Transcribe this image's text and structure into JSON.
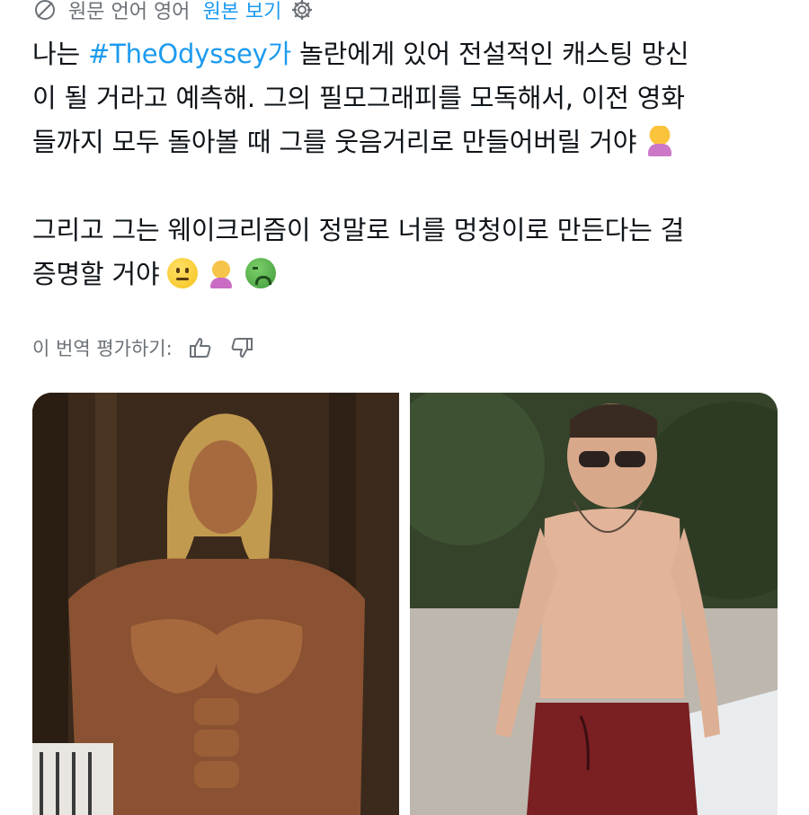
{
  "translate_bar": {
    "source_label": "원문 언어 영어",
    "view_original": "원본 보기",
    "globe_icon": "globe-icon",
    "settings_icon": "gear-icon"
  },
  "tweet": {
    "lines_p1": [
      "이 될 거라고 예측해. 그의 필모그래피를 모독해서, 이전 영화",
      "들까지 모두 돌아볼 때 그를 웃음거리로 만들어버릴 거야"
    ],
    "p1_start": "나는 ",
    "hashtag": "#TheOdyssey가",
    "p1_after_hashtag": " 놀란에게 있어 전설적인 캐스팅 망신",
    "p2_line1": "그리고 그는 웨이크리즘이 정말로 너를 멍청이로 만든다는 걸",
    "p2_line2": "증명할 거야",
    "emojis": [
      "woman-shrugging",
      "neutral-face",
      "woman-facepalming",
      "nauseated-face"
    ]
  },
  "rating": {
    "label": "이 번역 평가하기:",
    "thumbs_up_icon": "thumbs-up-icon",
    "thumbs_down_icon": "thumbs-down-icon"
  },
  "media": {
    "images": [
      {
        "alt": "shirtless-muscular-man-photo"
      },
      {
        "alt": "shirtless-man-sunglasses-photo"
      }
    ]
  },
  "colors": {
    "link": "#1d9bf0",
    "muted": "#6b7177",
    "text": "#0f1419"
  }
}
